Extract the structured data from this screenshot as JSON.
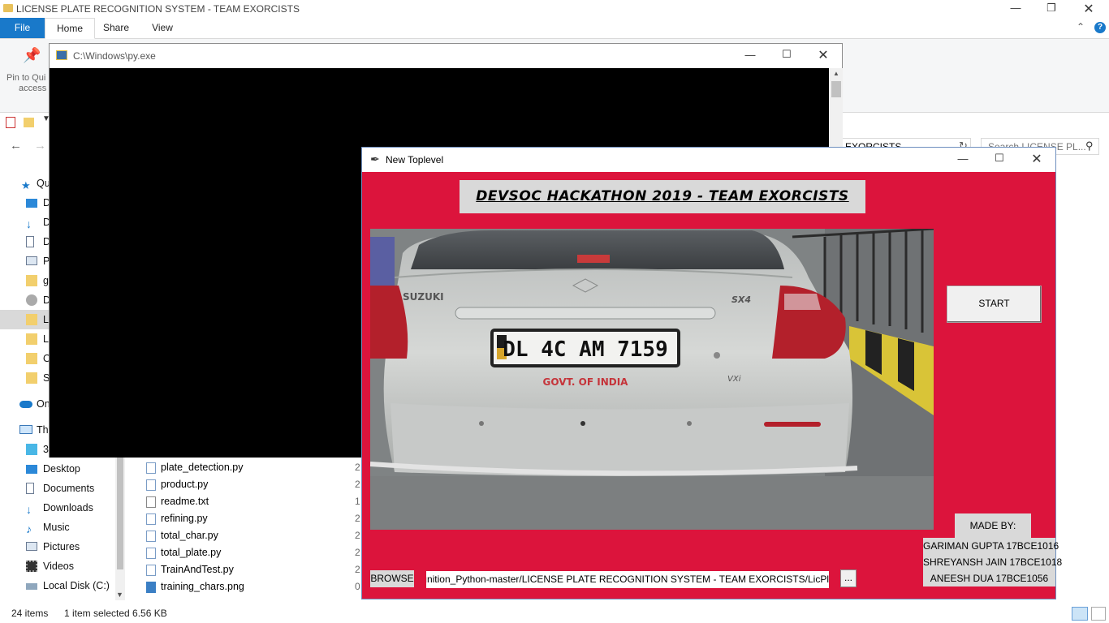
{
  "explorer": {
    "title": "LICENSE PLATE RECOGNITION SYSTEM - TEAM EXORCISTS",
    "tabs": [
      "File",
      "Home",
      "Share",
      "View"
    ],
    "ribbon_pin": "Pin to Quick access",
    "ribbon_pin_line1": "Pin to Qui",
    "ribbon_pin_line2": "access",
    "breadcrumb_tail": "EXORCISTS",
    "search_placeholder": "Search LICENSE PL...",
    "nav_items": [
      {
        "label": "Qu"
      },
      {
        "label": "D"
      },
      {
        "label": "D"
      },
      {
        "label": "D"
      },
      {
        "label": "P"
      },
      {
        "label": "g"
      },
      {
        "label": "D"
      },
      {
        "label": "L"
      },
      {
        "label": "L"
      },
      {
        "label": "O"
      },
      {
        "label": "S"
      },
      {
        "label": "On"
      },
      {
        "label": "Th"
      },
      {
        "label": "3"
      },
      {
        "label": "Desktop"
      },
      {
        "label": "Documents"
      },
      {
        "label": "Downloads"
      },
      {
        "label": "Music"
      },
      {
        "label": "Pictures"
      },
      {
        "label": "Videos"
      },
      {
        "label": "Local Disk (C:)"
      }
    ],
    "files": [
      {
        "name": "plate_detection.py",
        "date": "2"
      },
      {
        "name": "product.py",
        "date": "2"
      },
      {
        "name": "readme.txt",
        "date": "1"
      },
      {
        "name": "refining.py",
        "date": "2"
      },
      {
        "name": "total_char.py",
        "date": "2"
      },
      {
        "name": "total_plate.py",
        "date": "2"
      },
      {
        "name": "TrainAndTest.py",
        "date": "2"
      },
      {
        "name": "training_chars.png",
        "date": "0"
      }
    ],
    "status": {
      "count": "24 items",
      "selected": "1 item selected  6.56 KB"
    }
  },
  "console": {
    "title": "C:\\Windows\\py.exe"
  },
  "toplevel": {
    "title": "New Toplevel",
    "heading": "DEVSOC HACKATHON 2019 - TEAM EXORCISTS",
    "start_label": "START",
    "made_by_label": "MADE BY:",
    "credits": [
      "GARIMAN GUPTA 17BCE1016",
      "SHREYANSH JAIN 17BCE1018",
      "ANEESH DUA 17BCE1056"
    ],
    "browse_label": "BROWSE",
    "path_value": "Recognition_Python-master/LICENSE PLATE RECOGNITION SYSTEM - TEAM EXORCISTS/LicPl",
    "dots_label": "...",
    "photo": {
      "plate_text": "DL 4C AM 7159",
      "brand_text": "SUZUKI",
      "model_text": "SX4",
      "govt_text": "GOVT. OF INDIA",
      "variant_text": "VXi"
    }
  },
  "colors": {
    "toplevel_bg": "#dc143c",
    "file_tab": "#1979ca",
    "console_bg": "#000000"
  }
}
